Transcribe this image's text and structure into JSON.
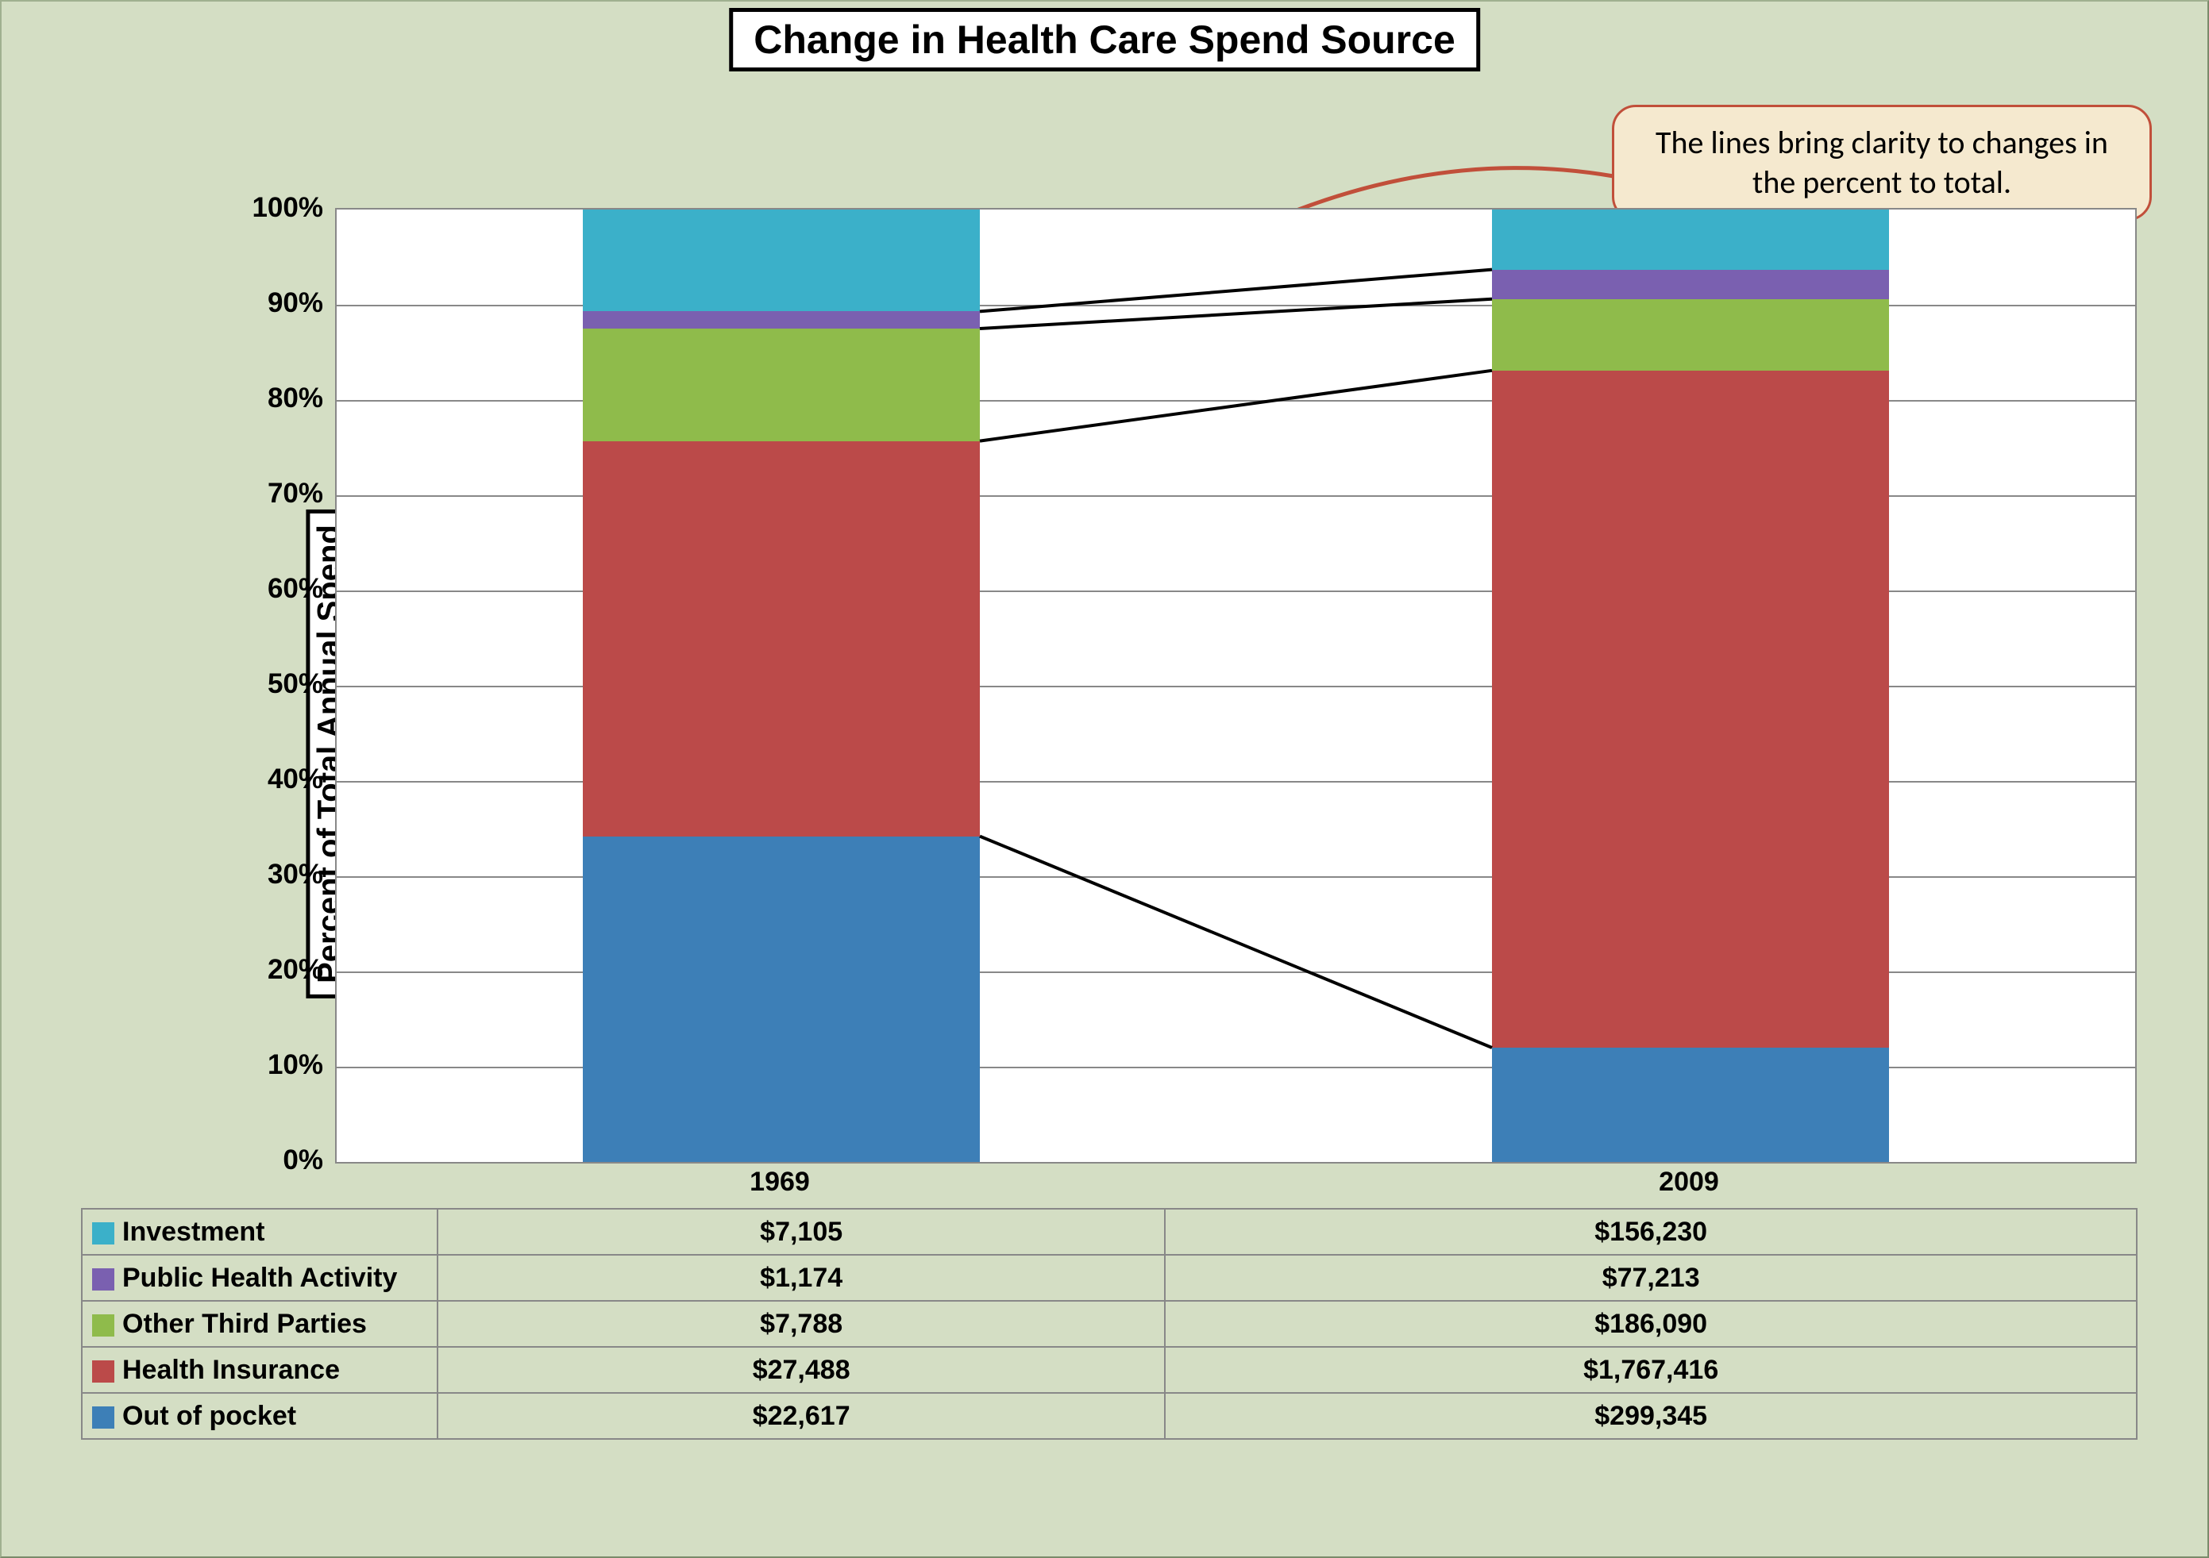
{
  "title": "Change in Health Care Spend Source",
  "ylabel": "Percent of Total Annual Spend",
  "callout_text": "The lines bring clarity to changes in the percent to total.",
  "categories": [
    "1969",
    "2009"
  ],
  "yticks": [
    "0%",
    "10%",
    "20%",
    "30%",
    "40%",
    "50%",
    "60%",
    "70%",
    "80%",
    "90%",
    "100%"
  ],
  "series": [
    {
      "name": "Investment",
      "color": "#3bb0c9",
      "legend_prefix": "■ "
    },
    {
      "name": "Public Health Activity",
      "color": "#7a60b0",
      "legend_prefix": "■ "
    },
    {
      "name": "Other Third Parties",
      "color": "#8fbb4b",
      "legend_prefix": "■ "
    },
    {
      "name": "Health Insurance",
      "color": "#bb4a49",
      "legend_prefix": "■ "
    },
    {
      "name": "Out of pocket",
      "color": "#3d7fb7",
      "legend_prefix": "■ "
    }
  ],
  "table_values": {
    "Investment": [
      "$7,105",
      "$156,230"
    ],
    "Public Health Activity": [
      "$1,174",
      "$77,213"
    ],
    "Other Third Parties": [
      "$7,788",
      "$186,090"
    ],
    "Health Insurance": [
      "$27,488",
      "$1,767,416"
    ],
    "Out of pocket": [
      "$22,617",
      "$299,345"
    ]
  },
  "chart_data": {
    "type": "bar",
    "stacked": true,
    "percent": true,
    "title": "Change in Health Care Spend Source",
    "ylabel": "Percent of Total Annual Spend",
    "xlabel": "",
    "ylim": [
      0,
      100
    ],
    "categories": [
      "1969",
      "2009"
    ],
    "series": [
      {
        "name": "Out of pocket",
        "raw": [
          22617,
          299345
        ],
        "pct": [
          34.2,
          12.0
        ],
        "color": "#3d7fb7"
      },
      {
        "name": "Health Insurance",
        "raw": [
          27488,
          1767416
        ],
        "pct": [
          41.5,
          71.1
        ],
        "color": "#bb4a49"
      },
      {
        "name": "Other Third Parties",
        "raw": [
          7788,
          186090
        ],
        "pct": [
          11.8,
          7.5
        ],
        "color": "#8fbb4b"
      },
      {
        "name": "Public Health Activity",
        "raw": [
          1174,
          77213
        ],
        "pct": [
          1.8,
          3.1
        ],
        "color": "#7a60b0"
      },
      {
        "name": "Investment",
        "raw": [
          7105,
          156230
        ],
        "pct": [
          10.7,
          6.3
        ],
        "color": "#3bb0c9"
      }
    ],
    "connectors_between_bars": true,
    "annotation": "The lines bring clarity to changes in the percent to total."
  }
}
